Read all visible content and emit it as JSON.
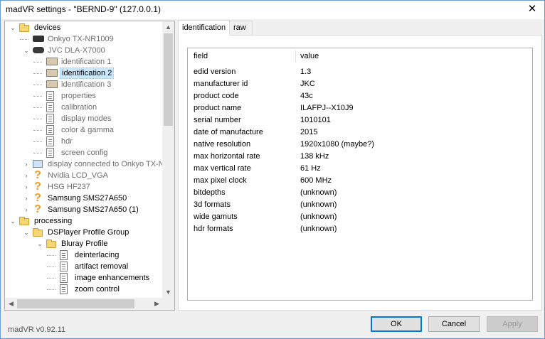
{
  "window": {
    "title": "madVR settings - \"BERND-9\" (127.0.0.1)",
    "close_glyph": "✕"
  },
  "tree": {
    "items": [
      {
        "label": "devices",
        "icon": "folder-icon",
        "expanded": true
      },
      {
        "label": "Onkyo TX-NR1009",
        "icon": "avr-icon",
        "gray": true
      },
      {
        "label": "JVC DLA-X7000",
        "icon": "projector-icon",
        "gray": true,
        "expanded": true
      },
      {
        "label": "identification 1",
        "icon": "identification-icon",
        "gray": true
      },
      {
        "label": "identification 2",
        "icon": "identification-icon",
        "selected": true
      },
      {
        "label": "identification 3",
        "icon": "identification-icon",
        "gray": true
      },
      {
        "label": "properties",
        "icon": "document-icon",
        "gray": true
      },
      {
        "label": "calibration",
        "icon": "document-icon",
        "gray": true
      },
      {
        "label": "display modes",
        "icon": "document-icon",
        "gray": true
      },
      {
        "label": "color & gamma",
        "icon": "document-icon",
        "gray": true
      },
      {
        "label": "hdr",
        "icon": "document-icon",
        "gray": true
      },
      {
        "label": "screen config",
        "icon": "document-icon",
        "gray": true
      },
      {
        "label": "display connected to Onkyo TX-N",
        "icon": "monitor-icon",
        "gray": true
      },
      {
        "label": "Nvidia LCD_VGA",
        "icon": "question-icon",
        "gray": true
      },
      {
        "label": "HSG HF237",
        "icon": "question-icon",
        "gray": true
      },
      {
        "label": "Samsung SMS27A650",
        "icon": "question-icon"
      },
      {
        "label": "Samsung SMS27A650 (1)",
        "icon": "question-icon"
      },
      {
        "label": "processing",
        "icon": "folder-icon",
        "expanded": true
      },
      {
        "label": "DSPlayer Profile Group",
        "icon": "folder-icon",
        "expanded": true
      },
      {
        "label": "Bluray Profile",
        "icon": "folder-icon",
        "expanded": true
      },
      {
        "label": "deinterlacing",
        "icon": "document-icon"
      },
      {
        "label": "artifact removal",
        "icon": "document-icon"
      },
      {
        "label": "image enhancements",
        "icon": "document-icon"
      },
      {
        "label": "zoom control",
        "icon": "document-icon"
      }
    ]
  },
  "tabs": [
    {
      "label": "identification",
      "active": true
    },
    {
      "label": "raw edid data",
      "active": false
    }
  ],
  "table": {
    "headers": {
      "field": "field",
      "value": "value"
    },
    "rows": [
      {
        "field": "edid version",
        "value": "1.3"
      },
      {
        "field": "manufacturer id",
        "value": "JKC"
      },
      {
        "field": "product code",
        "value": "43c"
      },
      {
        "field": "product name",
        "value": "ILAFPJ--X10J9"
      },
      {
        "field": "serial number",
        "value": "1010101"
      },
      {
        "field": "date of manufacture",
        "value": "2015"
      },
      {
        "field": "native resolution",
        "value": "1920x1080 (maybe?)"
      },
      {
        "field": "max horizontal rate",
        "value": "138 kHz"
      },
      {
        "field": "max vertical rate",
        "value": "61 Hz"
      },
      {
        "field": "max pixel clock",
        "value": "600 MHz"
      },
      {
        "field": "bitdepths",
        "value": "(unknown)"
      },
      {
        "field": "3d formats",
        "value": "(unknown)"
      },
      {
        "field": "wide gamuts",
        "value": "(unknown)"
      },
      {
        "field": "hdr formats",
        "value": "(unknown)"
      }
    ]
  },
  "footer": {
    "version": "madVR v0.92.11",
    "ok_label": "OK",
    "cancel_label": "Cancel",
    "apply_label": "Apply"
  }
}
